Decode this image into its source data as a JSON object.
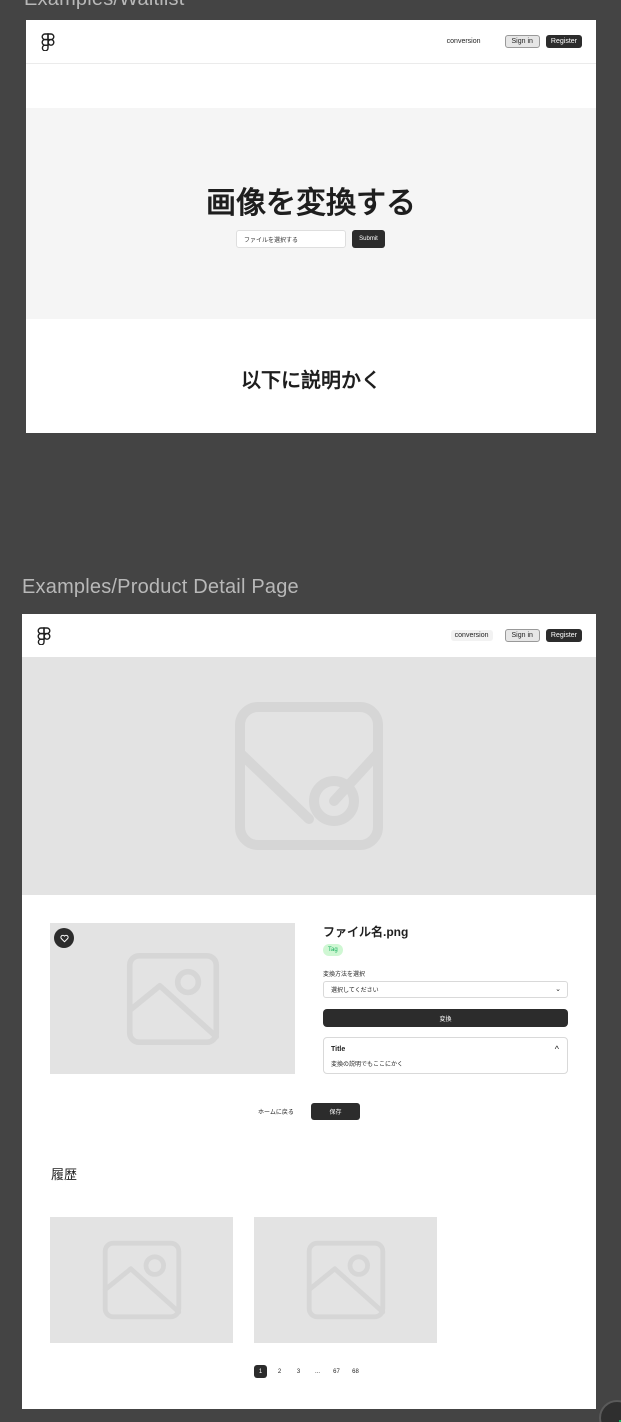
{
  "frames": {
    "waitlist_label": "Examples/Waitlist",
    "product_label": "Examples/Product Detail Page"
  },
  "waitlist": {
    "nav": {
      "link": "conversion",
      "sign_in": "Sign in",
      "register": "Register"
    },
    "hero": {
      "title": "画像を変換する",
      "file_input": "ファイルを選択する",
      "submit": "Submit"
    },
    "section_title": "以下に説明かく"
  },
  "product": {
    "nav": {
      "link": "conversion",
      "sign_in": "Sign in",
      "register": "Register"
    },
    "name": "ファイル名.png",
    "tag": "Tag",
    "select_label": "変換方法を選択",
    "select_value": "選択してください",
    "convert_button": "変換",
    "accordion": {
      "title": "Title",
      "body": "変換の説明でもここにかく"
    },
    "back_link": "ホームに戻る",
    "save_button": "保存",
    "history_title": "履歴",
    "pagination": [
      "1",
      "2",
      "3",
      "...",
      "67",
      "68"
    ]
  },
  "colors": {
    "brand_dark": "#2c2c2c",
    "tag_green": "#14ae5c",
    "tag_bg": "#cff7d3",
    "placeholder": "#e3e3e3"
  },
  "icons": [
    "figma-logo-icon",
    "image-placeholder-icon",
    "heart-icon",
    "chevron-down-icon",
    "chevron-up-icon"
  ]
}
